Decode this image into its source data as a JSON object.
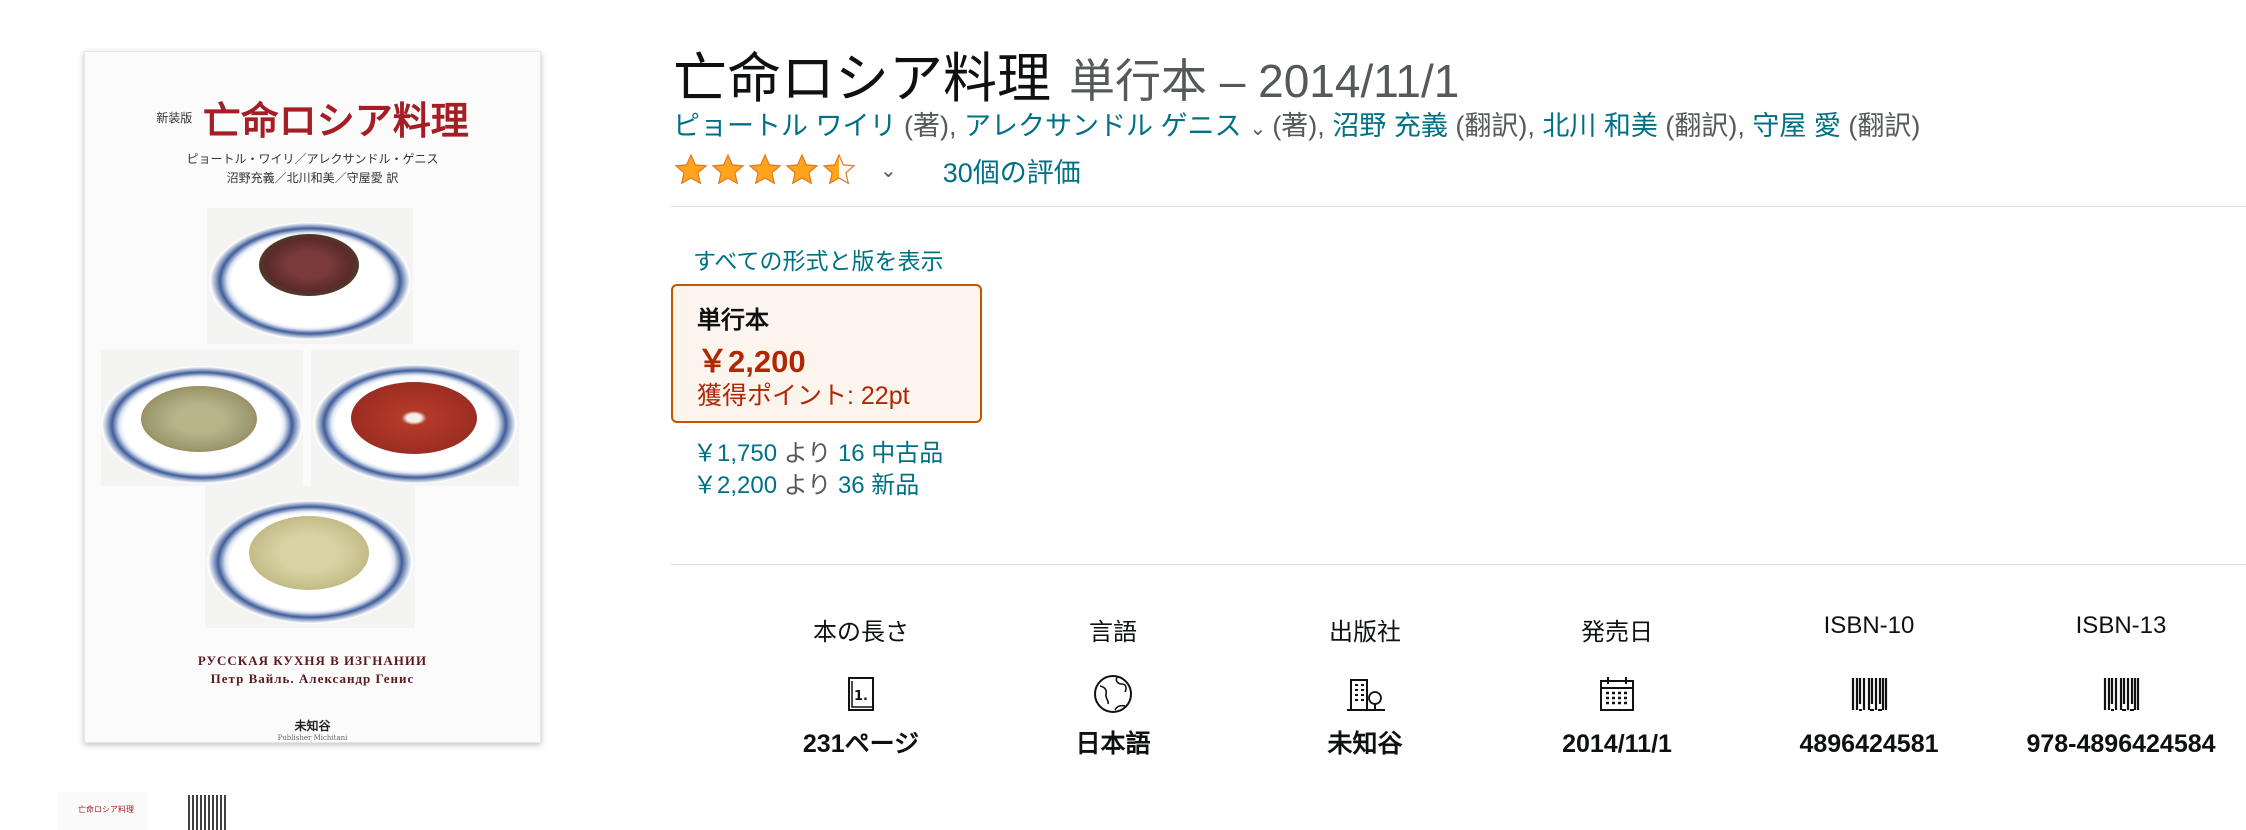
{
  "cover": {
    "edition": "新装版",
    "title": "亡命ロシア料理",
    "authors_line1": "ピョートル・ワイリ／アレクサンドル・ゲニス",
    "authors_line2": "沼野充義／北川和美／守屋愛 訳",
    "latin_line1": "РУССКАЯ КУХНЯ В ИЗГНАНИИ",
    "latin_line2": "Петр Вайль. Александр Генис",
    "publisher": "未知谷",
    "publisher_en": "Publisher Michitani",
    "thumb_title": "亡命ロシア料理"
  },
  "product": {
    "title": "亡命ロシア料理",
    "subtitle": "単行本 – 2014/11/1",
    "authors": [
      {
        "name": "ピョートル ワイリ",
        "role": "(著),"
      },
      {
        "name": "アレクサンドル ゲニス",
        "role": "(著),"
      },
      {
        "name": "沼野 充義",
        "role": "(翻訳),"
      },
      {
        "name": "北川 和美",
        "role": "(翻訳),"
      },
      {
        "name": "守屋 愛",
        "role": "(翻訳)"
      }
    ],
    "rating_stars": 4.5,
    "ratings_text": "30個の評価"
  },
  "formats": {
    "all_formats_link": "すべての形式と版を表示",
    "selected": {
      "name": "単行本",
      "price": "￥2,200",
      "points": "獲得ポイント: 22pt"
    },
    "offers": [
      {
        "price": "￥1,750",
        "from": "より",
        "count_label": "16 中古品"
      },
      {
        "price": "￥2,200",
        "from": "より",
        "count_label": "36 新品"
      }
    ]
  },
  "attributes": [
    {
      "label": "本の長さ",
      "icon": "page-icon",
      "value": "231ページ"
    },
    {
      "label": "言語",
      "icon": "globe-icon",
      "value": "日本語"
    },
    {
      "label": "出版社",
      "icon": "building-icon",
      "value": "未知谷"
    },
    {
      "label": "発売日",
      "icon": "calendar-icon",
      "value": "2014/11/1"
    },
    {
      "label": "ISBN-10",
      "icon": "barcode-icon",
      "value": "4896424581"
    },
    {
      "label": "ISBN-13",
      "icon": "barcode-icon",
      "value": "978-4896424584"
    }
  ],
  "colors": {
    "link": "#007185",
    "price": "#b12704",
    "star": "#ffa41c",
    "selected_border": "#c45500",
    "cover_title": "#a51d25"
  }
}
